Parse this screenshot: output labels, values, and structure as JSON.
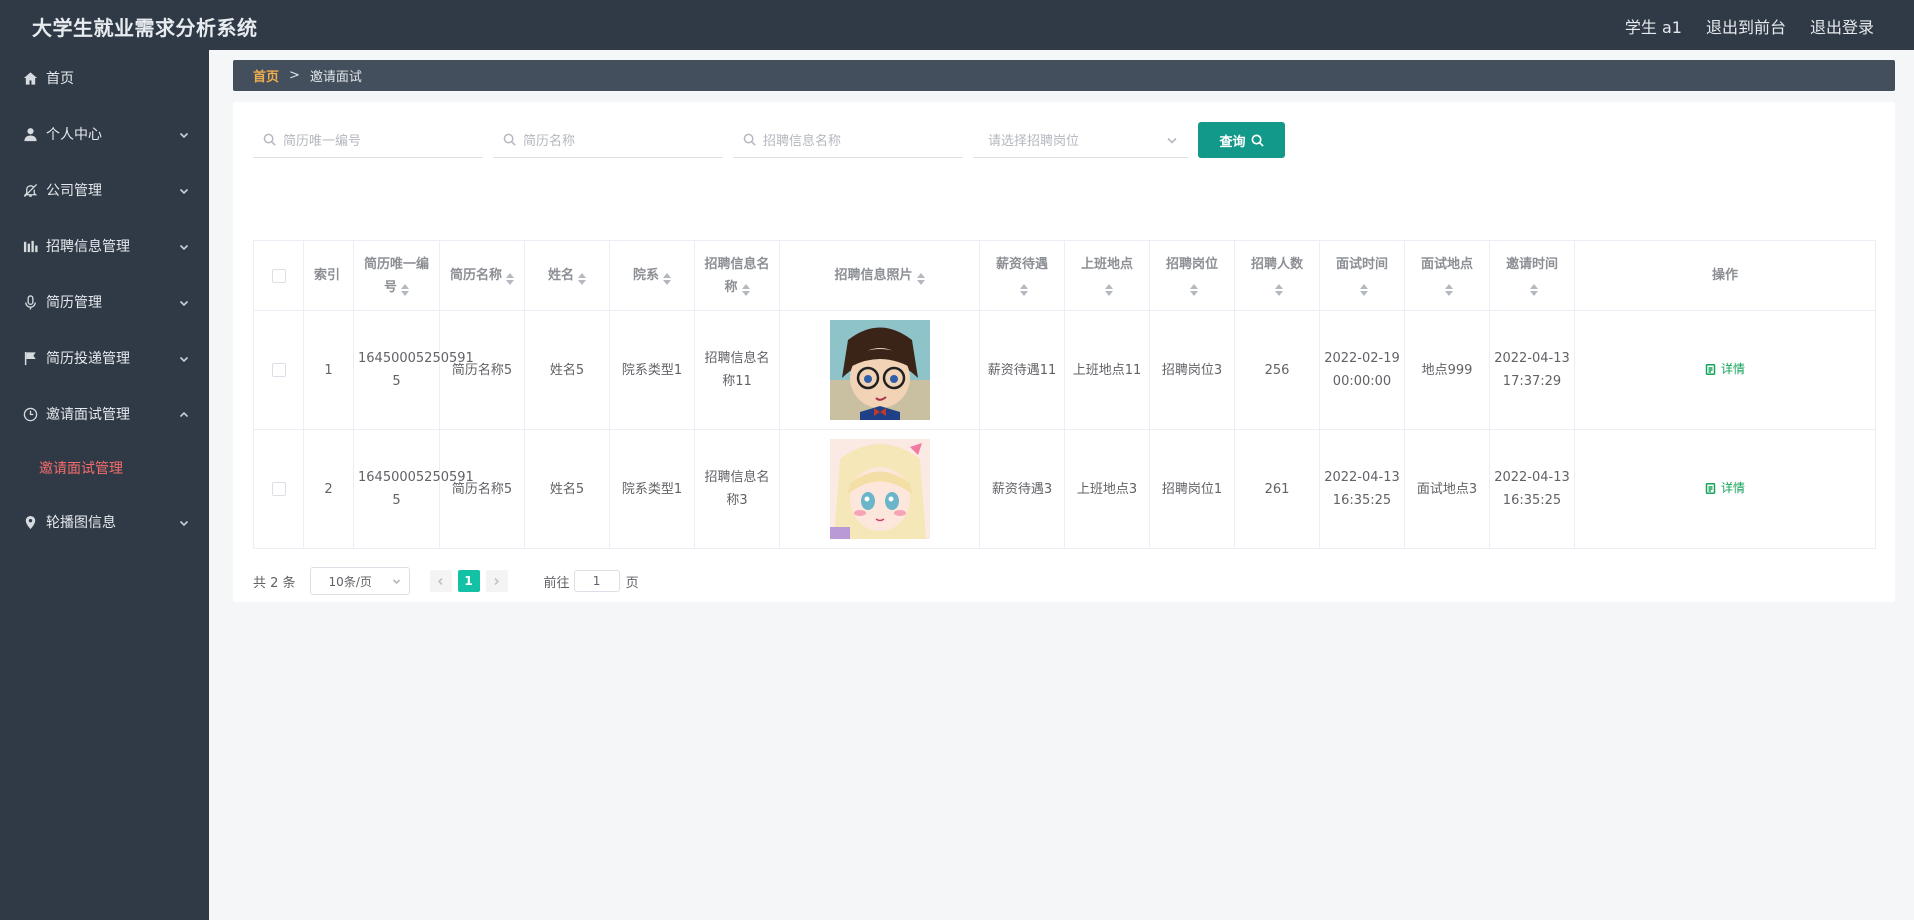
{
  "header": {
    "app_title": "大学生就业需求分析系统",
    "user": "学生 a1",
    "to_front": "退出到前台",
    "logout": "退出登录"
  },
  "sidebar": {
    "items": [
      {
        "label": "首页",
        "icon": "home-icon",
        "has_children": false
      },
      {
        "label": "个人中心",
        "icon": "user-icon",
        "has_children": true
      },
      {
        "label": "公司管理",
        "icon": "bell-off-icon",
        "has_children": true
      },
      {
        "label": "招聘信息管理",
        "icon": "bar-chart-icon",
        "has_children": true
      },
      {
        "label": "简历管理",
        "icon": "microphone-icon",
        "has_children": true
      },
      {
        "label": "简历投递管理",
        "icon": "flag-icon",
        "has_children": true
      },
      {
        "label": "邀请面试管理",
        "icon": "clock-icon",
        "has_children": true,
        "expanded": true
      },
      {
        "label": "轮播图信息",
        "icon": "location-icon",
        "has_children": true
      }
    ],
    "active_subitem": "邀请面试管理"
  },
  "breadcrumb": {
    "home": "首页",
    "separator": ">",
    "current": "邀请面试"
  },
  "search": {
    "resume_id_placeholder": "简历唯一编号",
    "resume_name_placeholder": "简历名称",
    "job_info_placeholder": "招聘信息名称",
    "position_placeholder": "请选择招聘岗位",
    "query_label": "查询"
  },
  "table": {
    "headers": {
      "index": "索引",
      "resume_id": "简历唯一编号",
      "resume_name": "简历名称",
      "name": "姓名",
      "department": "院系",
      "job_name": "招聘信息名称",
      "job_photo": "招聘信息照片",
      "salary": "薪资待遇",
      "location": "上班地点",
      "position": "招聘岗位",
      "headcount": "招聘人数",
      "interview_time": "面试时间",
      "interview_place": "面试地点",
      "invite_time": "邀请时间",
      "actions": "操作"
    },
    "rows": [
      {
        "index": "1",
        "resume_id": "16450005250591 5",
        "resume_name": "简历名称5",
        "name": "姓名5",
        "department": "院系类型1",
        "job_name": "招聘信息名称11",
        "photo": "anime-boy-glasses",
        "salary": "薪资待遇11",
        "location": "上班地点11",
        "position": "招聘岗位3",
        "headcount": "256",
        "interview_time": "2022-02-19 00:00:00",
        "interview_place": "地点999",
        "invite_time": "2022-04-13 17:37:29",
        "action": "详情"
      },
      {
        "index": "2",
        "resume_id": "16450005250591 5",
        "resume_name": "简历名称5",
        "name": "姓名5",
        "department": "院系类型1",
        "job_name": "招聘信息名称3",
        "photo": "anime-girl-blonde",
        "salary": "薪资待遇3",
        "location": "上班地点3",
        "position": "招聘岗位1",
        "headcount": "261",
        "interview_time": "2022-04-13 16:35:25",
        "interview_place": "面试地点3",
        "invite_time": "2022-04-13 16:35:25",
        "action": "详情"
      }
    ]
  },
  "pagination": {
    "total": "共 2 条",
    "page_size": "10条/页",
    "current_page": "1",
    "goto_label": "前往",
    "goto_value": "1",
    "page_unit": "页"
  },
  "colors": {
    "sidebar_bg": "#2f3a46",
    "accent": "#13998a",
    "active_menu": "#f56c6c",
    "breadcrumb_home": "#f0ad4e",
    "detail_link": "#13a35a"
  }
}
